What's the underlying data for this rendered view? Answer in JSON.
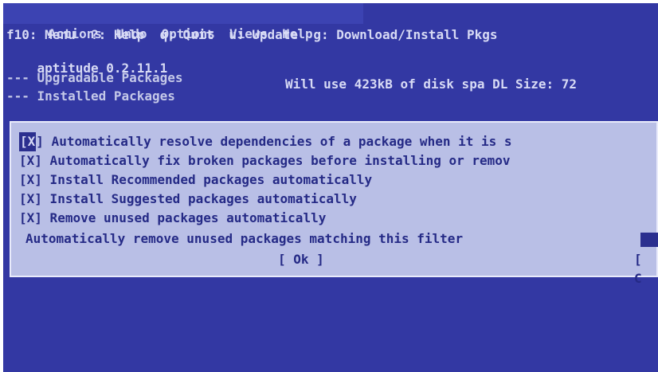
{
  "menubar": {
    "items": [
      "Actions",
      "Undo",
      "Options",
      "Views",
      "Help"
    ]
  },
  "keybindings": "f10: Menu  ?: Help  q: Quit  u: Update  g: Download/Install Pkgs",
  "status": {
    "version": "aptitude 0.2.11.1",
    "disk": "Will use 423kB of disk spa DL Size: 72"
  },
  "tree": [
    "--- Upgradable Packages",
    "--- Installed Packages"
  ],
  "dialog": {
    "options": [
      {
        "box_open": "[",
        "box_mark": "X",
        "box_close": "]",
        "label": " Automatically resolve dependencies of a package when it is s",
        "focused": true
      },
      {
        "box_open": "[",
        "box_mark": "X",
        "box_close": "]",
        "label": " Automatically fix broken packages before installing or remov",
        "focused": false
      },
      {
        "box_open": "[",
        "box_mark": "X",
        "box_close": "]",
        "label": " Install Recommended packages automatically",
        "focused": false
      },
      {
        "box_open": "[",
        "box_mark": "X",
        "box_close": "]",
        "label": " Install Suggested packages automatically",
        "focused": false
      },
      {
        "box_open": "[",
        "box_mark": "X",
        "box_close": "]",
        "label": " Remove unused packages automatically",
        "focused": false
      }
    ],
    "filter_label": "Automatically remove unused packages matching this filter",
    "ok_label": "[ Ok ]",
    "cancel_label": "[ C"
  }
}
